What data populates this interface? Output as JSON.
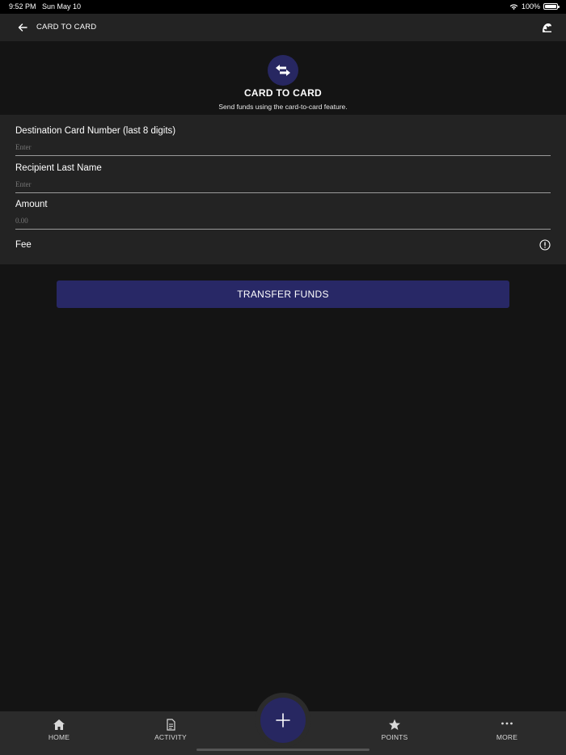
{
  "status_bar": {
    "time": "9:52 PM",
    "date": "Sun May 10",
    "battery": "100%",
    "icons": [
      "wifi-icon",
      "battery-icon"
    ]
  },
  "nav": {
    "title": "CARD TO CARD",
    "back_icon": "back-arrow-icon",
    "brand_icon": "taco-bell-logo-icon"
  },
  "header": {
    "icon": "transfer-arrows-icon",
    "title": "CARD TO CARD",
    "subtitle": "Send funds using the card-to-card feature."
  },
  "form": {
    "destination": {
      "label": "Destination Card Number (last 8 digits)",
      "placeholder": "Enter",
      "value": ""
    },
    "recipient": {
      "label": "Recipient Last Name",
      "placeholder": "Enter",
      "value": ""
    },
    "amount": {
      "label": "Amount",
      "placeholder": "0.00",
      "value": ""
    },
    "fee": {
      "label": "Fee",
      "icon": "info-icon"
    }
  },
  "transfer_button": {
    "label": "TRANSFER FUNDS"
  },
  "tab_bar": {
    "tabs": [
      {
        "label": "HOME",
        "icon": "home-icon"
      },
      {
        "label": "ACTIVITY",
        "icon": "document-icon"
      },
      {
        "label": "POINTS",
        "icon": "star-icon"
      },
      {
        "label": "MORE",
        "icon": "more-dots-icon"
      }
    ],
    "fab_icon": "plus-icon"
  },
  "colors": {
    "background": "#141414",
    "panel": "#232323",
    "accent": "#282866",
    "tab_bar": "#2b2b2b"
  }
}
